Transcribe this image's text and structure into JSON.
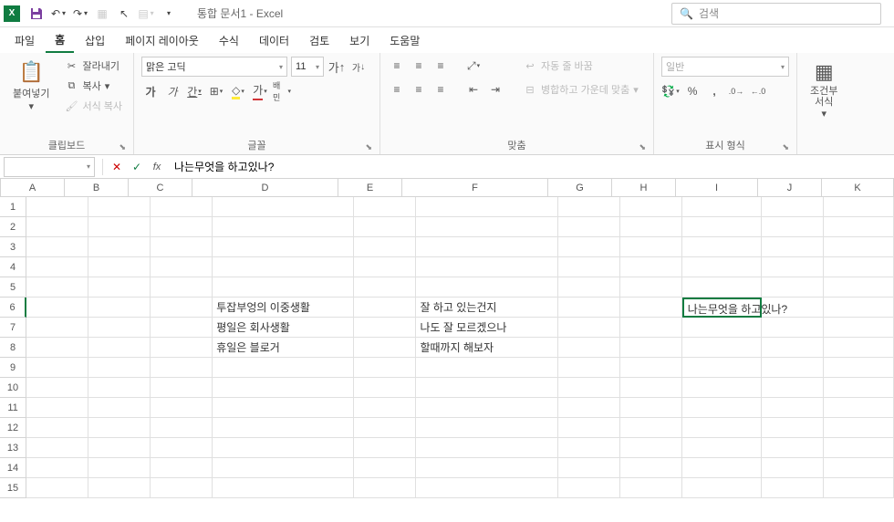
{
  "app": {
    "title": "통합 문서1  -  Excel",
    "icon_letter": "X"
  },
  "search": {
    "placeholder": "검색"
  },
  "tabs": [
    "파일",
    "홈",
    "삽입",
    "페이지 레이아웃",
    "수식",
    "데이터",
    "검토",
    "보기",
    "도움말"
  ],
  "active_tab": 1,
  "ribbon": {
    "clipboard": {
      "label": "클립보드",
      "paste": "붙여넣기",
      "cut": "잘라내기",
      "copy": "복사",
      "format_painter": "서식 복사"
    },
    "font": {
      "label": "글꼴",
      "name": "맑은 고딕",
      "size": "11",
      "grow": "가",
      "shrink": "가",
      "bold": "가",
      "italic": "가",
      "underline": "간",
      "color": "가",
      "ruby": "배민"
    },
    "align": {
      "label": "맞춤",
      "wrap": "자동 줄 바꿈",
      "merge": "병합하고 가운데 맞춤"
    },
    "number": {
      "label": "표시 형식",
      "format": "일반",
      "percent": "%",
      "comma": ","
    },
    "styles": {
      "label": "조건부\n서식"
    }
  },
  "formula": {
    "text": "나는무엇을 하고있나?"
  },
  "columns": [
    "A",
    "B",
    "C",
    "D",
    "E",
    "F",
    "G",
    "H",
    "I",
    "J",
    "K"
  ],
  "rows": [
    1,
    2,
    3,
    4,
    5,
    6,
    7,
    8,
    9,
    10,
    11,
    12,
    13,
    14,
    15
  ],
  "cells": {
    "D6": "투잡부엉의 이중생활",
    "D7": "평일은 회사생활",
    "D8": "휴일은 블로거",
    "F6": "잘 하고 있는건지",
    "F7": "나도 잘 모르겠으나",
    "F8": "할때까지 해보자",
    "I6": "나는무엇을 하고있나?"
  },
  "editing_cell": "I6"
}
